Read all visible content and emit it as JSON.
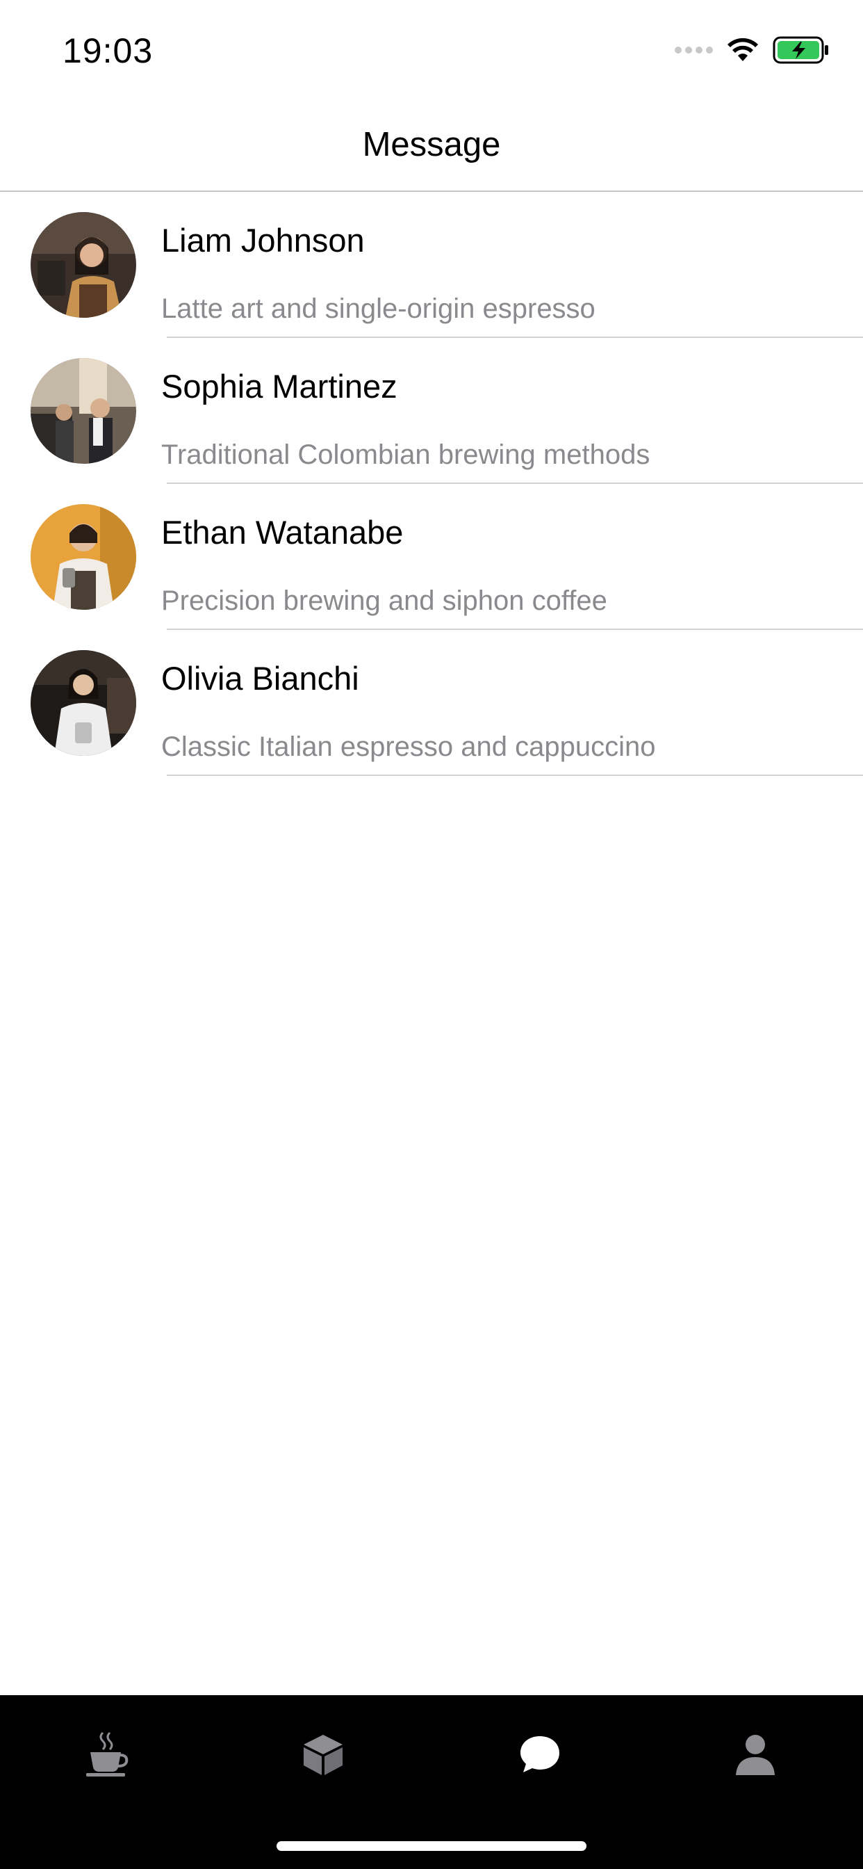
{
  "status_bar": {
    "time": "19:03"
  },
  "header": {
    "title": "Message"
  },
  "messages": [
    {
      "name": "Liam Johnson",
      "subtitle": "Latte art and single-origin espresso",
      "avatar": "avatar-barista-1"
    },
    {
      "name": "Sophia Martinez",
      "subtitle": "Traditional Colombian brewing methods",
      "avatar": "avatar-barista-2"
    },
    {
      "name": "Ethan Watanabe",
      "subtitle": "Precision brewing and siphon coffee",
      "avatar": "avatar-barista-3"
    },
    {
      "name": "Olivia Bianchi",
      "subtitle": "Classic Italian espresso and cappuccino",
      "avatar": "avatar-barista-4"
    }
  ],
  "tab_bar": {
    "tabs": [
      {
        "icon": "coffee-cup-icon",
        "active": false
      },
      {
        "icon": "box-icon",
        "active": false
      },
      {
        "icon": "chat-bubble-icon",
        "active": true
      },
      {
        "icon": "person-icon",
        "active": false
      }
    ],
    "active_color": "#ffffff",
    "inactive_color": "#8e8e93"
  },
  "colors": {
    "battery_fill": "#34c759"
  }
}
